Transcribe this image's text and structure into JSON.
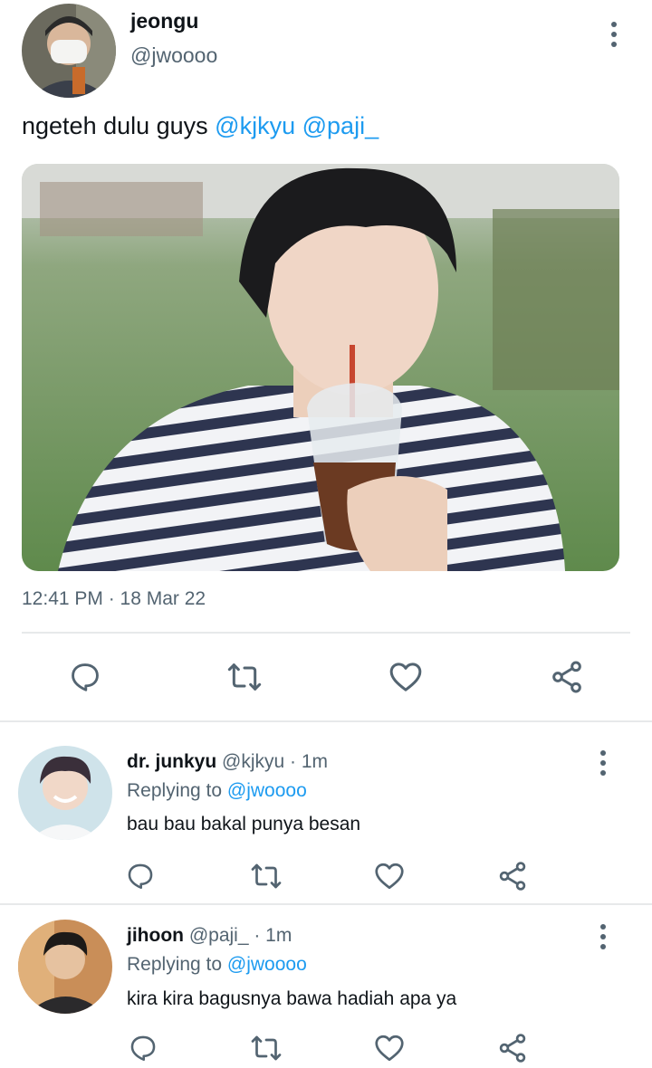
{
  "tweet": {
    "display_name": "jeongu",
    "handle": "@jwoooo",
    "text_prefix": "ngeteh dulu guys ",
    "mention_1": "@kjkyu",
    "mention_2": "@paji_",
    "timestamp": "12:41 PM · 18 Mar 22",
    "avatar_icon": "avatar-photo-masked",
    "media_alt": "photo-person-drinking-iced-tea"
  },
  "actions": {
    "reply_icon": "comment-bubble-icon",
    "retweet_icon": "retweet-arrows-icon",
    "like_icon": "heart-outline-icon",
    "share_icon": "share-nodes-icon"
  },
  "replies": [
    {
      "display_name": "dr. junkyu",
      "handle_time": "@kjkyu · 1m",
      "replying_prefix": "Replying to ",
      "replying_to": "@jwoooo",
      "text": "bau bau bakal punya besan"
    },
    {
      "display_name": "jihoon",
      "handle_time": "@paji_ · 1m",
      "replying_prefix": "Replying to ",
      "replying_to": "@jwoooo",
      "text": "kira kira bagusnya bawa hadiah apa ya"
    }
  ],
  "colors": {
    "link": "#1d9bf0",
    "muted": "#536471",
    "divider": "#e7e9ea"
  }
}
